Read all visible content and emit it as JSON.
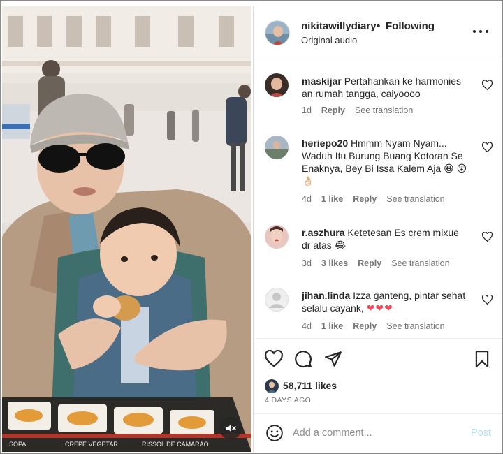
{
  "post": {
    "username": "nikitawillydiary",
    "separator": "•",
    "follow_status": "Following",
    "audio": "Original audio",
    "more_icon": "more-horizontal-icon"
  },
  "media": {
    "sign_texts": [
      "CREPE VEGETAR",
      "RISSOL DE CAMARÃO",
      "SOPA"
    ],
    "mute_icon": "speaker-muted-icon"
  },
  "comments": [
    {
      "username": "maskijar",
      "text": "Pertahankan ke harmonies an rumah tangga, caiyoooo",
      "time": "1d",
      "likes": "",
      "reply": "Reply",
      "see_translation": "See translation"
    },
    {
      "username": "heriepo20",
      "text": "Hmmm Nyam Nyam... Waduh Itu Burung Buang Kotoran Se Enaknya, Bey Bi Issa Kalem Aja 😀 😲👌🏻",
      "time": "4d",
      "likes": "1 like",
      "reply": "Reply",
      "see_translation": "See translation"
    },
    {
      "username": "r.aszhura",
      "text": "Ketetesan Es crem mixue dr atas 😂",
      "time": "3d",
      "likes": "3 likes",
      "reply": "Reply",
      "see_translation": "See translation"
    },
    {
      "username": "jihan.linda",
      "text": "Izza ganteng, pintar sehat selalu cayank,",
      "hearts": "❤❤❤",
      "time": "4d",
      "likes": "1 like",
      "reply": "Reply",
      "see_translation": "See translation"
    }
  ],
  "actions": {
    "like_icon": "heart-icon",
    "comment_icon": "comment-bubble-icon",
    "share_icon": "paper-plane-icon",
    "save_icon": "bookmark-icon"
  },
  "likes": "58,711 likes",
  "date": "4 DAYS AGO",
  "add_comment": {
    "placeholder": "Add a comment...",
    "post_label": "Post",
    "emoji_icon": "smiley-icon"
  },
  "colors": {
    "text": "#262626",
    "secondary": "#737373",
    "heart_red": "#ed4956",
    "post_disabled": "#b2dffc",
    "border": "#dbdbdb"
  }
}
